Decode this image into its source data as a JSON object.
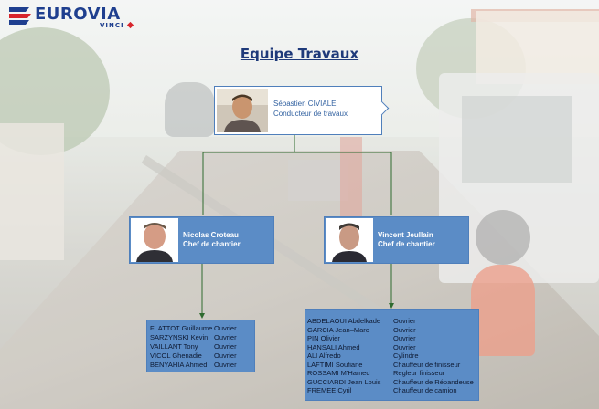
{
  "logo": {
    "brand": "EUROVIA",
    "sub": "VINCI",
    "brand_colors": {
      "blue": "#1f3f8f",
      "red": "#d7252c"
    }
  },
  "title": "Equipe Travaux",
  "colors": {
    "card_fill": "#5b8cc6",
    "card_border": "#4f7fbb",
    "title": "#1f3a7a",
    "connector": "#2f6b2f"
  },
  "top": {
    "name": "Sébastien CIVIALE",
    "role": "Conducteur de  travaux"
  },
  "left": {
    "name": "Nicolas Croteau",
    "role": "Chef de chantier",
    "team": [
      {
        "name": "FLATTOT Guillaume",
        "role": "Ouvrier"
      },
      {
        "name": "SARZYNSKI Kevin",
        "role": "Ouvrier"
      },
      {
        "name": "VAILLANT Tony",
        "role": "Ouvrier"
      },
      {
        "name": "VICOL Ghenadie",
        "role": "Ouvrier"
      },
      {
        "name": "BENYAHIA Ahmed",
        "role": "Ouvrier"
      }
    ]
  },
  "right": {
    "name": "Vincent Jeullain",
    "role": "Chef de chantier",
    "team": [
      {
        "name": "ABDELAOUI Abdelkade",
        "role": "Ouvrier"
      },
      {
        "name": "GARCIA Jean–Marc",
        "role": "Ouvrier"
      },
      {
        "name": "PIN Olivier",
        "role": "Ouvrier"
      },
      {
        "name": "HANSALI Ahmed",
        "role": "Ouvrier"
      },
      {
        "name": "ALI Alfredo",
        "role": "Cylindre"
      },
      {
        "name": "LAFTIMI Soufiane",
        "role": "Chauffeur de finisseur"
      },
      {
        "name": "ROSSAMI M'Hamed",
        "role": "Regleur finisseur"
      },
      {
        "name": "GUCCIARDI  Jean Louis",
        "role": "Chauffeur de Répandeuse"
      },
      {
        "name": "FREMEE Cyril",
        "role": "Chauffeur de camion"
      }
    ]
  }
}
